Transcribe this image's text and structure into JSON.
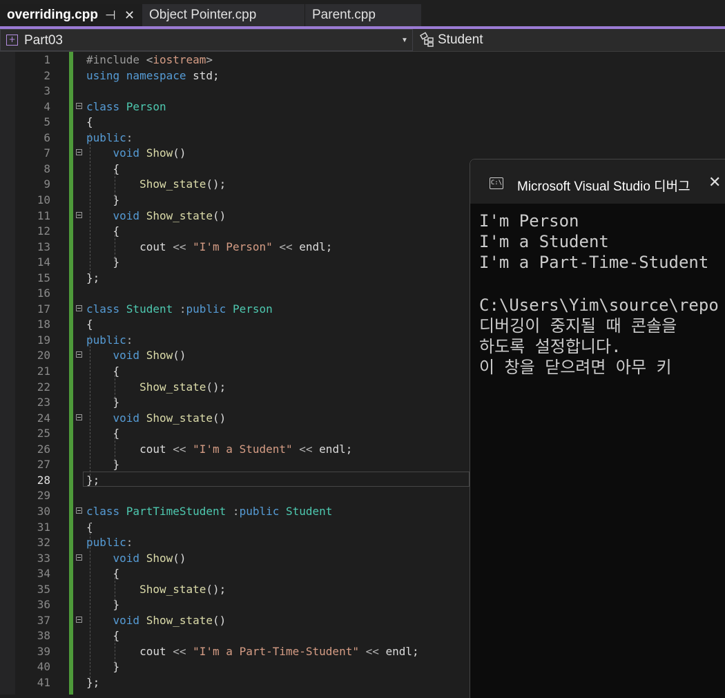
{
  "tabs": [
    {
      "label": "overriding.cpp",
      "active": true
    },
    {
      "label": "Object Pointer.cpp",
      "active": false
    },
    {
      "label": "Parent.cpp",
      "active": false
    }
  ],
  "tab_pin_icon": "⊣",
  "tab_close_icon": "✕",
  "nav": {
    "project": "Part03",
    "scope": "Student",
    "dropdown_icon": "▼"
  },
  "editor": {
    "current_line": 28,
    "line_numbers": [
      "1",
      "2",
      "3",
      "4",
      "5",
      "6",
      "7",
      "8",
      "9",
      "10",
      "11",
      "12",
      "13",
      "14",
      "15",
      "16",
      "17",
      "18",
      "19",
      "20",
      "21",
      "22",
      "23",
      "24",
      "25",
      "26",
      "27",
      "28",
      "29",
      "30",
      "31",
      "32",
      "33",
      "34",
      "35",
      "36",
      "37",
      "38",
      "39",
      "40",
      "41"
    ]
  },
  "console": {
    "title": "Microsoft Visual Studio 디버그",
    "icon_text": "C:\\",
    "close_icon": "✕",
    "lines": [
      "I'm Person",
      "I'm a Student",
      "I'm a Part-Time-Student",
      "",
      "C:\\Users\\Yim\\source\\repo",
      "디버깅이 중지될 때 콘솔을",
      "하도록 설정합니다.",
      "이 창을 닫으려면 아무 키"
    ]
  }
}
